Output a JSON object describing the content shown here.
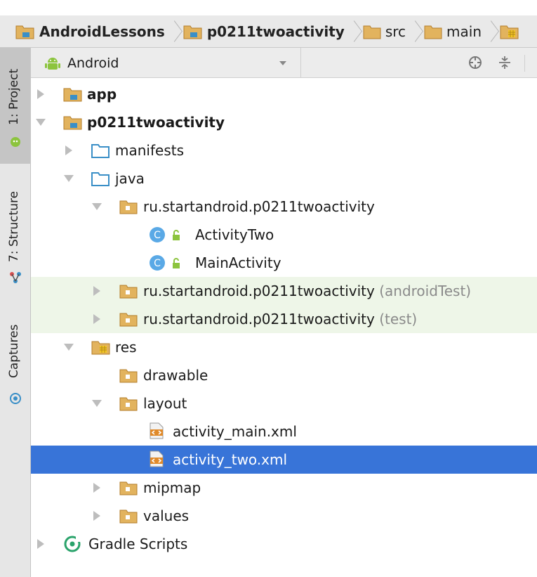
{
  "breadcrumb": [
    {
      "label": "AndroidLessons",
      "icon": "module-folder-icon"
    },
    {
      "label": "p0211twoactivity",
      "icon": "module-folder-icon"
    },
    {
      "label": "src",
      "icon": "folder-icon"
    },
    {
      "label": "main",
      "icon": "folder-icon"
    },
    {
      "label": "",
      "icon": "resource-folder-icon"
    }
  ],
  "sidebar": {
    "project_tab": "1: Project",
    "structure_tab": "7: Structure",
    "captures_tab": "Captures"
  },
  "toolbar": {
    "view_selector": "Android"
  },
  "tree": {
    "app": "app",
    "module": "p0211twoactivity",
    "manifests": "manifests",
    "java": "java",
    "package": "ru.startandroid.p0211twoactivity",
    "activity_two": "ActivityTwo",
    "main_activity": "MainActivity",
    "package_android_test": "ru.startandroid.p0211twoactivity",
    "android_test_suffix": "(androidTest)",
    "package_test": "ru.startandroid.p0211twoactivity",
    "test_suffix": "(test)",
    "res": "res",
    "drawable": "drawable",
    "layout": "layout",
    "activity_main_xml": "activity_main.xml",
    "activity_two_xml": "activity_two.xml",
    "mipmap": "mipmap",
    "values": "values",
    "gradle_scripts": "Gradle Scripts"
  },
  "colors": {
    "selection": "#3874d8",
    "test_row_highlight": "#eef6e8",
    "folder_orange": "#d9a24a",
    "folder_blue": "#3a8fc7",
    "android_green": "#8cc43e"
  }
}
